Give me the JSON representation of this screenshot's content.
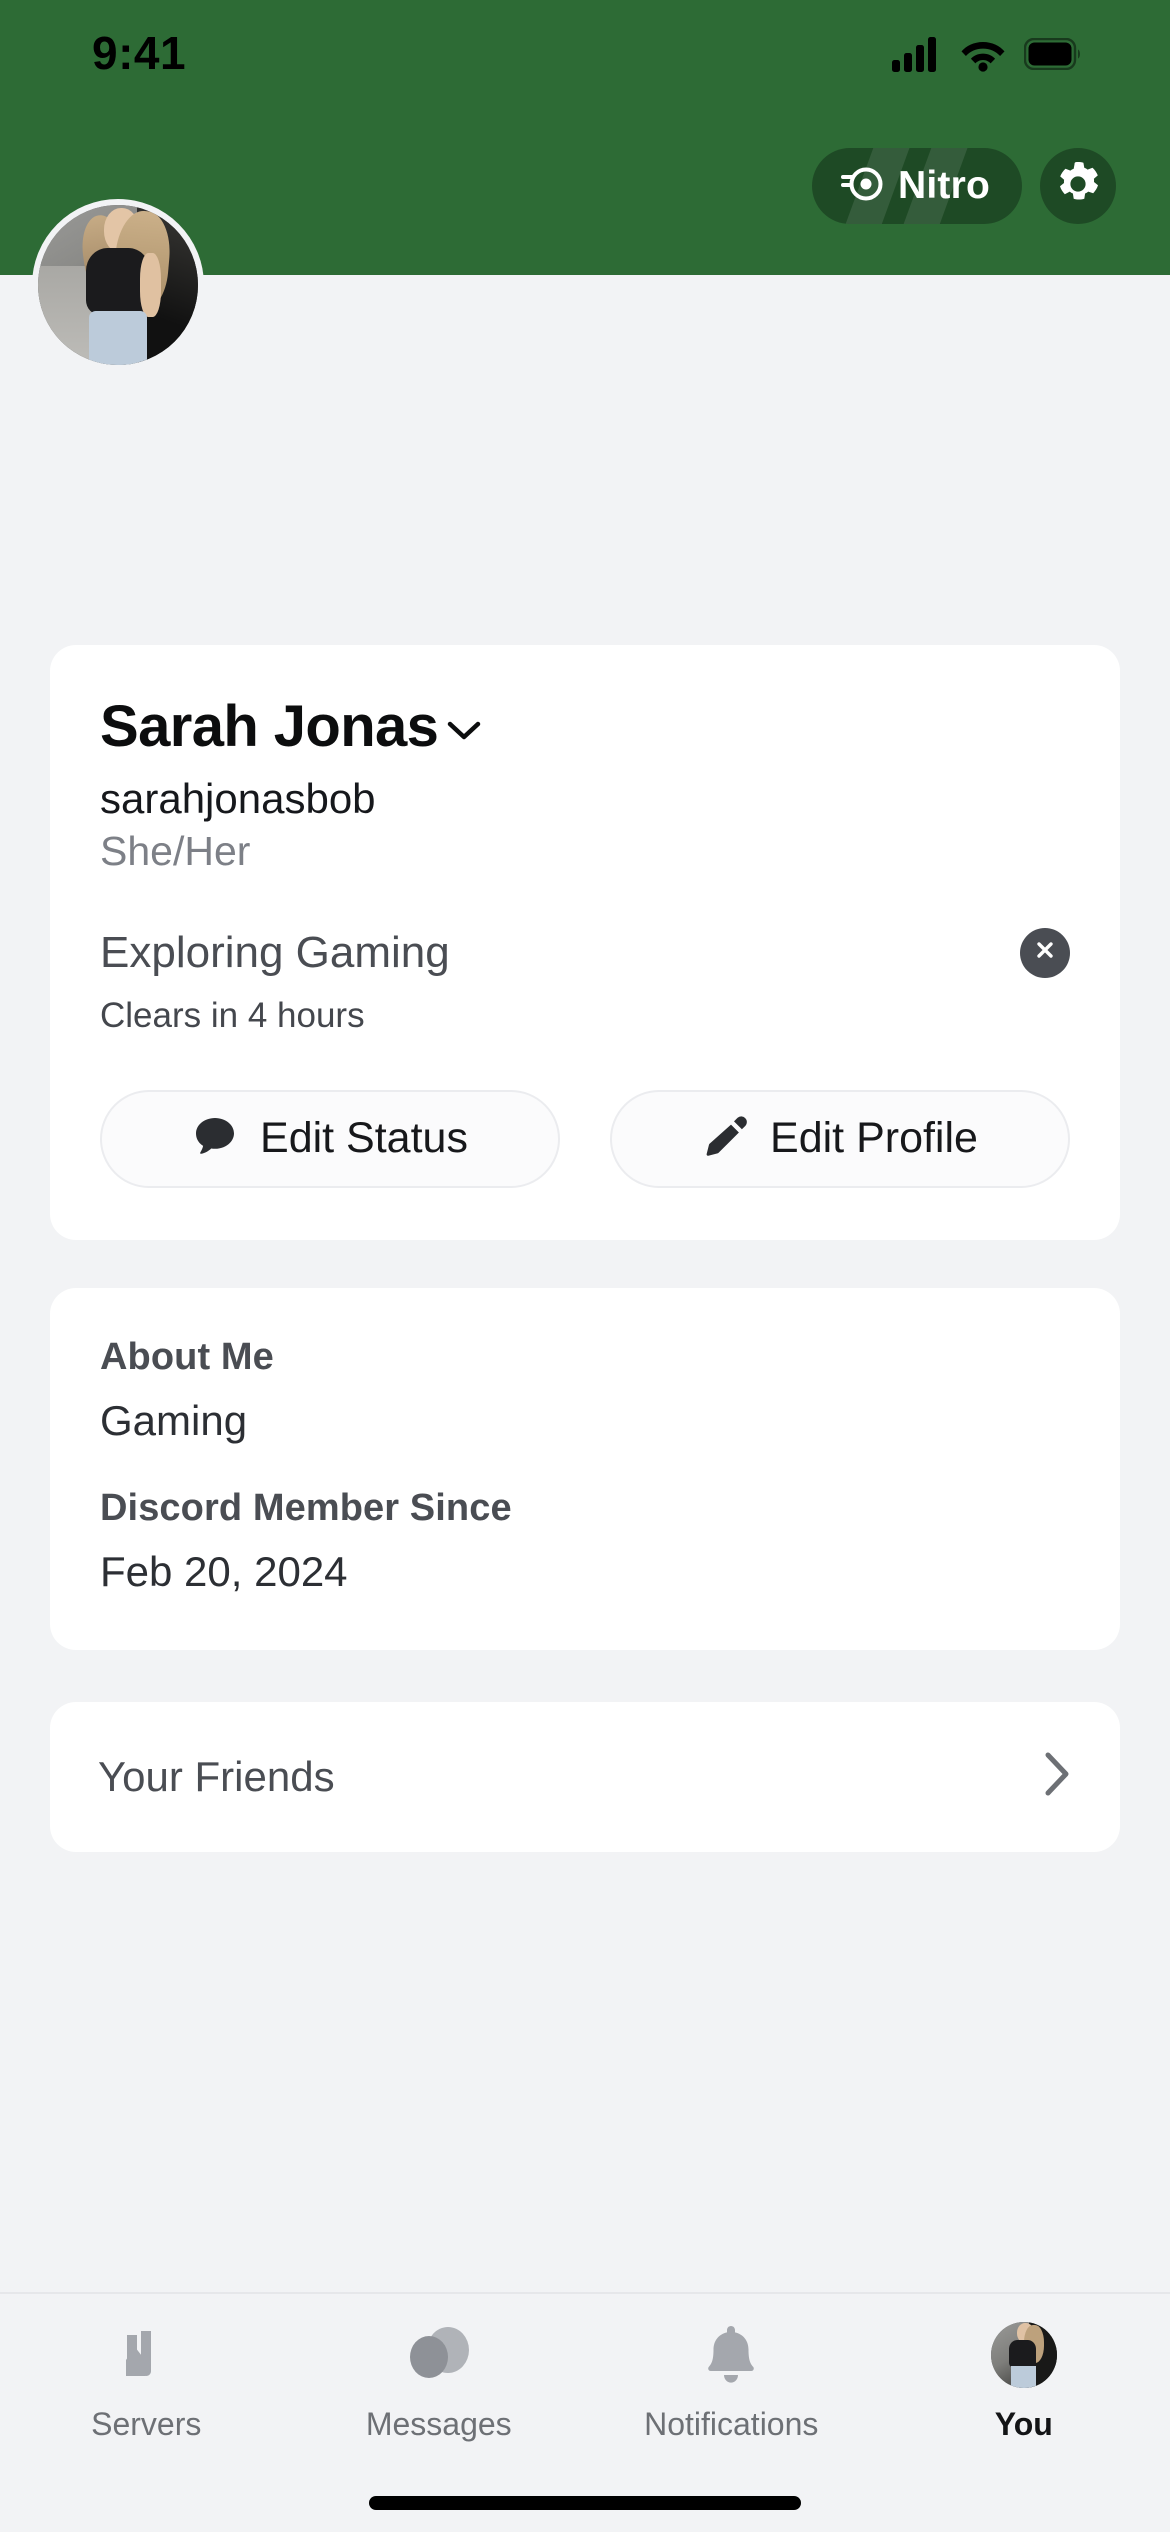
{
  "status_bar": {
    "time": "9:41",
    "cellular_icon": "cellular-signal-icon",
    "wifi_icon": "wifi-icon",
    "battery_icon": "battery-icon"
  },
  "header": {
    "background_color": "#2d6b35",
    "nitro": {
      "label": "Nitro",
      "icon": "nitro-wheel-icon"
    },
    "settings": {
      "icon": "gear-icon"
    }
  },
  "avatar": {
    "icon": "user-avatar-photo"
  },
  "profile": {
    "display_name": "Sarah Jonas",
    "name_chevron_icon": "chevron-down-icon",
    "username": "sarahjonasbob",
    "pronouns": "She/Her",
    "custom_status": "Exploring Gaming",
    "clear_status_icon": "close-circle-icon",
    "clears_in": "Clears in 4 hours",
    "edit_status_button": {
      "label": "Edit Status",
      "icon": "chat-bubble-icon"
    },
    "edit_profile_button": {
      "label": "Edit Profile",
      "icon": "pencil-icon"
    }
  },
  "about": {
    "about_me_heading": "About Me",
    "about_me_value": "Gaming",
    "member_since_heading": "Discord Member Since",
    "member_since_value": "Feb 20, 2024"
  },
  "friends": {
    "label": "Your Friends",
    "chevron_icon": "chevron-right-icon"
  },
  "tabbar": {
    "items": [
      {
        "label": "Servers",
        "icon": "servers-icon",
        "active": false
      },
      {
        "label": "Messages",
        "icon": "messages-icon",
        "active": false
      },
      {
        "label": "Notifications",
        "icon": "bell-icon",
        "active": false
      },
      {
        "label": "You",
        "icon": "user-avatar-photo",
        "active": true
      }
    ]
  },
  "colors": {
    "banner_green": "#2d6b35",
    "nitro_pill": "#1e4a25",
    "page_bg": "#f2f3f5",
    "card_bg": "#ffffff"
  }
}
